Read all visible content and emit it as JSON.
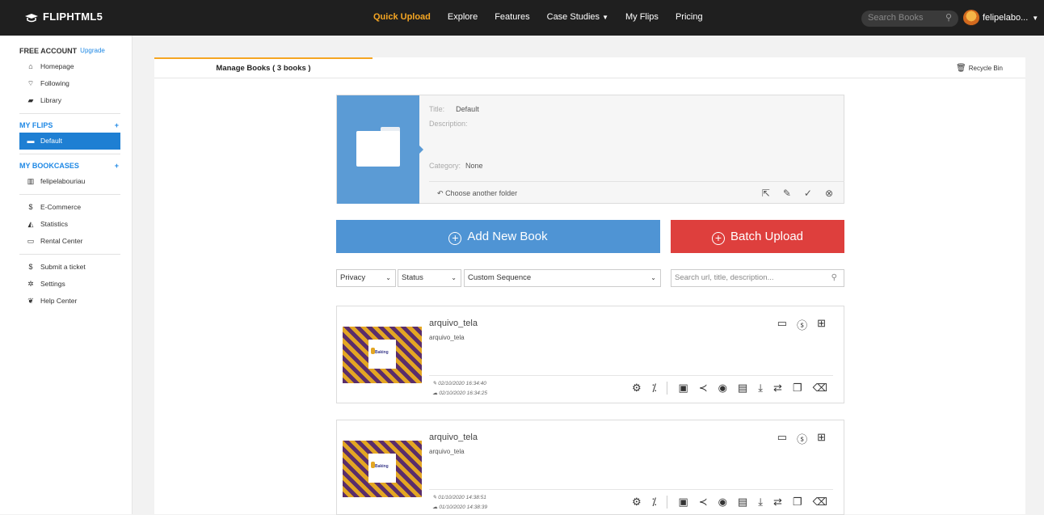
{
  "header": {
    "logo": "FLIPHTML5",
    "nav": [
      "Quick Upload",
      "Explore",
      "Features",
      "Case Studies",
      "My Flips",
      "Pricing"
    ],
    "search_placeholder": "Search Books",
    "username": "felipelabo..."
  },
  "sidebar": {
    "account_label": "FREE ACCOUNT",
    "upgrade_label": "Upgrade",
    "top_items": [
      {
        "label": "Homepage",
        "icon": "home-icon"
      },
      {
        "label": "Following",
        "icon": "rss-icon"
      },
      {
        "label": "Library",
        "icon": "book-icon"
      }
    ],
    "my_flips_label": "MY FLIPS",
    "flips": [
      {
        "label": "Default",
        "icon": "folder-open-icon"
      }
    ],
    "my_bookcases_label": "MY BOOKCASES",
    "bookcases": [
      {
        "label": "felipelabouriau",
        "icon": "bookshelf-icon"
      }
    ],
    "tools": [
      {
        "label": "E-Commerce",
        "icon": "dollar-icon"
      },
      {
        "label": "Statistics",
        "icon": "chart-icon"
      },
      {
        "label": "Rental Center",
        "icon": "card-icon"
      }
    ],
    "support": [
      {
        "label": "Submit a ticket",
        "icon": "dollar-icon"
      },
      {
        "label": "Settings",
        "icon": "gear-icon"
      },
      {
        "label": "Help Center",
        "icon": "leaf-icon"
      }
    ]
  },
  "main": {
    "tab_label": "Manage Books ( 3 books )",
    "recycle_label": "Recycle Bin",
    "folder": {
      "title_label": "Title:",
      "title_value": "Default",
      "description_label": "Description:",
      "category_label": "Category:",
      "category_value": "None",
      "choose_label": "Choose another folder"
    },
    "add_button": "Add New Book",
    "batch_button": "Batch Upload",
    "filters": {
      "privacy": "Privacy",
      "status": "Status",
      "sequence": "Custom Sequence",
      "search_placeholder": "Search url, title, description..."
    },
    "books": [
      {
        "title": "arquivo_tela",
        "subtitle": "arquivo_tela",
        "modified": "02/10/2020 16:34:40",
        "uploaded": "02/10/2020 16:34:25",
        "thumb_label": "Baking"
      },
      {
        "title": "arquivo_tela",
        "subtitle": "arquivo_tela",
        "modified": "01/10/2020 14:38:51",
        "uploaded": "01/10/2020 14:38:39",
        "thumb_label": "Baking"
      }
    ]
  },
  "colors": {
    "accent": "#f5a623",
    "blue": "#4f94d4",
    "red": "#de3f3d",
    "sidebar_active": "#1e7fd3"
  }
}
